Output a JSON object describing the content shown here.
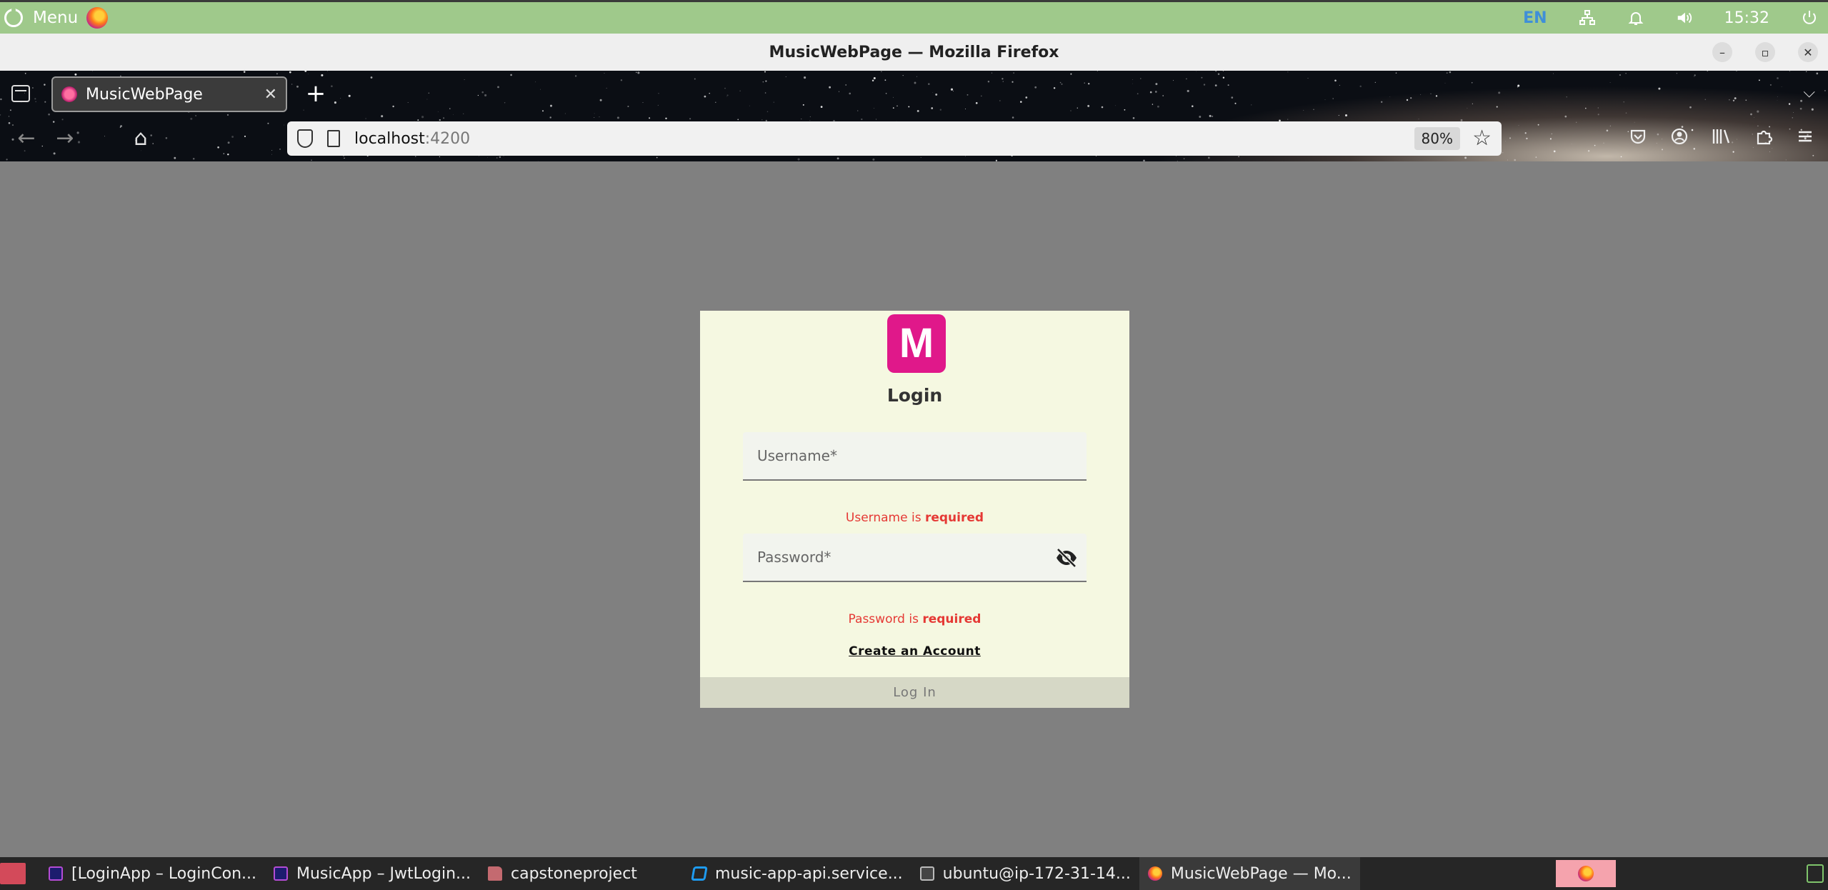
{
  "os_panel": {
    "menu_label": "Menu",
    "tray": {
      "language": "EN",
      "clock": "15:32"
    },
    "icons": [
      "ubuntu-icon",
      "firefox-icon",
      "network-icon",
      "notification-icon",
      "volume-icon",
      "power-icon"
    ]
  },
  "window": {
    "title": "MusicWebPage — Mozilla Firefox",
    "controls": {
      "minimize": "–",
      "maximize": "▫",
      "close": "✕"
    }
  },
  "tabs": [
    {
      "title": "MusicWebPage",
      "close": "✕",
      "active": true
    }
  ],
  "tabbar": {
    "new_tab": "+",
    "list_tabs": "⌵"
  },
  "navbar": {
    "back": "←",
    "forward": "→",
    "home": "⌂",
    "url_host": "localhost",
    "url_port": ":4200",
    "zoom": "80%",
    "bookmark_star": "☆"
  },
  "login": {
    "logo_letter": "M",
    "title": "Login",
    "username_placeholder": "Username*",
    "username_error_prefix": "Username is ",
    "username_error_strong": "required",
    "password_placeholder": "Password*",
    "password_error_prefix": "Password is ",
    "password_error_strong": "required",
    "create_account": "Create an Account",
    "login_button": "Log In"
  },
  "taskbar": {
    "items": [
      {
        "label": "[LoginApp – LoginCon...",
        "icon": "jetbrains-icon"
      },
      {
        "label": "MusicApp – JwtLogin...",
        "icon": "jetbrains-icon"
      },
      {
        "label": "capstoneproject",
        "icon": "folder-icon"
      },
      {
        "label": "music-app-api.service...",
        "icon": "vscode-icon"
      },
      {
        "label": "ubuntu@ip-172-31-14...",
        "icon": "terminal-icon"
      },
      {
        "label": "MusicWebPage — Mo...",
        "icon": "firefox-icon"
      }
    ]
  },
  "colors": {
    "panel": "#9fc98b",
    "page_background": "#808080",
    "card_background": "#f5f8e1",
    "logo_accent": "#e0188a",
    "error": "#e53935"
  }
}
